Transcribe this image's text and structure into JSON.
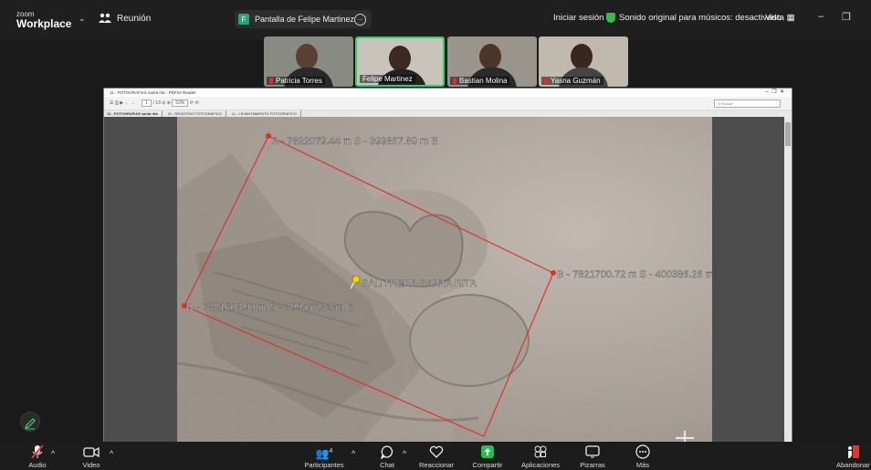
{
  "app": {
    "logo_top": "zoom",
    "logo_bottom": "Workplace"
  },
  "header": {
    "meeting_label": "Reunión",
    "share_pill": {
      "badge": "F",
      "text": "Pantalla de Felipe Martinez"
    },
    "signin": "Iniciar sesión",
    "sound": "Sonido original para músicos: desactivado",
    "view": "Vista"
  },
  "participants": [
    {
      "name": "Patricia Torres",
      "muted": true
    },
    {
      "name": "Felipe Martinez",
      "muted": false
    },
    {
      "name": "Bastian Molina",
      "muted": true
    },
    {
      "name": "Yasna Guzmán",
      "muted": true
    }
  ],
  "pdf": {
    "window_title": "11.- FOTOGRAFIAS santa rita - PDF24 Reader",
    "zoom": "63%",
    "page_of": "/ 13",
    "page_num": "1",
    "search_placeholder": "Q Buscar",
    "tabs": [
      "11.- FOTOGRAFIAS santa rita",
      "11.- REGISTRO FOTOGRAFICO",
      "11.- LEVANTAMIENTO FOTOGRAFICO"
    ]
  },
  "map": {
    "label_a": "A - 7822079.44 m S - 399857.89 m E",
    "label_b": "B - 7821700.72 m S - 400386.26 m",
    "label_d": "D - 7821608.90 m S - 399557.34 m E",
    "site": "SALITRERA SANTA RITA"
  },
  "toolbar": {
    "audio": "Audio",
    "video": "Video",
    "participants": "Participantes",
    "participants_count": "4",
    "chat": "Chat",
    "react": "Reaccionar",
    "share": "Compartir",
    "apps": "Aplicaciones",
    "whiteboards": "Pizarras",
    "more": "Más",
    "leave": "Abandonar"
  },
  "colors": {
    "share_green": "#1fc24f",
    "leave_red": "#e0362c",
    "boundary_red": "#e0302a"
  }
}
